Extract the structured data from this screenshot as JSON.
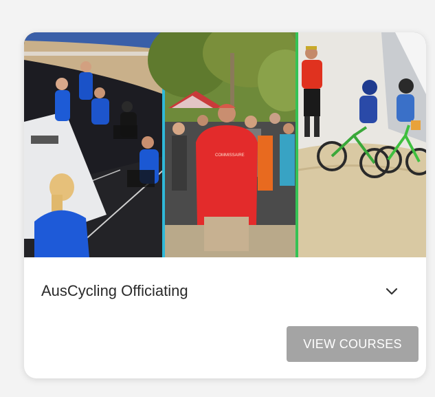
{
  "card": {
    "title": "AusCycling Officiating",
    "button_label": "VIEW COURSES",
    "expand_icon": "chevron-down-icon"
  },
  "banner": {
    "panels": [
      "track-cycling-officials-photo",
      "road-cycling-official-crowd-photo",
      "bmx-race-official-photo"
    ],
    "divider_colors": [
      "#2fb8d8",
      "#35c255"
    ]
  },
  "colors": {
    "button_bg": "#a4a4a4",
    "button_text": "#ffffff",
    "title_text": "#2a2a2a",
    "page_bg": "#f3f3f3"
  }
}
